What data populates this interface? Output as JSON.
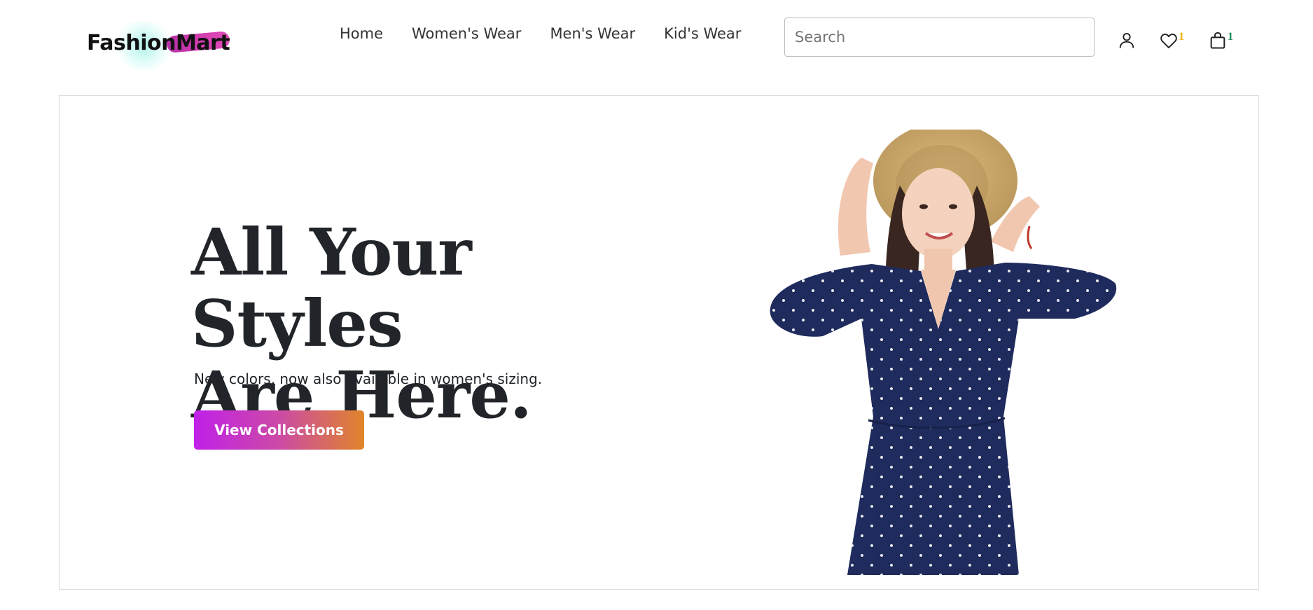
{
  "brand": {
    "name": "FashionMart"
  },
  "nav": {
    "items": [
      {
        "label": "Home"
      },
      {
        "label": "Women's Wear"
      },
      {
        "label": "Men's Wear"
      },
      {
        "label": "Kid's Wear"
      }
    ]
  },
  "search": {
    "placeholder": "Search",
    "value": ""
  },
  "header_icons": {
    "account": {
      "icon": "user-icon"
    },
    "wishlist": {
      "icon": "heart-icon",
      "count": "1",
      "badge_color": "#f0b400"
    },
    "cart": {
      "icon": "shopping-bag-icon",
      "count": "1",
      "badge_color": "#198754"
    }
  },
  "hero": {
    "title_line1": "All Your Styles",
    "title_line2": "Are Here.",
    "subtitle": "New colors, now also available in women's sizing.",
    "cta_label": "View Collections",
    "cta_gradient": [
      "#c020e8",
      "#e0852a"
    ],
    "image_alt": "woman in navy polka-dot jumpsuit and straw hat"
  }
}
